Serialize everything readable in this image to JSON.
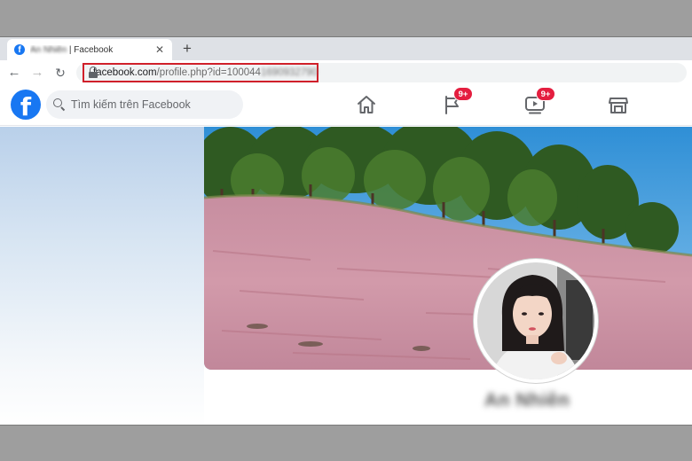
{
  "browser": {
    "tab": {
      "title_prefix": "An Nhiên",
      "title_suffix": " | Facebook",
      "favicon": "facebook-favicon",
      "close": "✕"
    },
    "new_tab": "+",
    "nav": {
      "back": "←",
      "forward": "→",
      "reload": "↻"
    },
    "url": {
      "host": "facebook.com",
      "path": "/profile.php?id=100044",
      "hidden_digits": "1690932790"
    },
    "highlight_color": "#d0202a"
  },
  "facebook": {
    "logo": "f",
    "search_placeholder": "Tìm kiếm trên Facebook",
    "nav": {
      "home_icon": "home-icon",
      "pages_icon": "flag-icon",
      "pages_badge": "9+",
      "watch_icon": "video-icon",
      "watch_badge": "9+",
      "marketplace_icon": "shop-icon"
    },
    "brand_color": "#1877f2",
    "badge_color": "#e41e3f"
  },
  "profile": {
    "name": "An Nhiên",
    "cover": "pink-grass-hill-pine-forest",
    "avatar": "profile-photo"
  }
}
